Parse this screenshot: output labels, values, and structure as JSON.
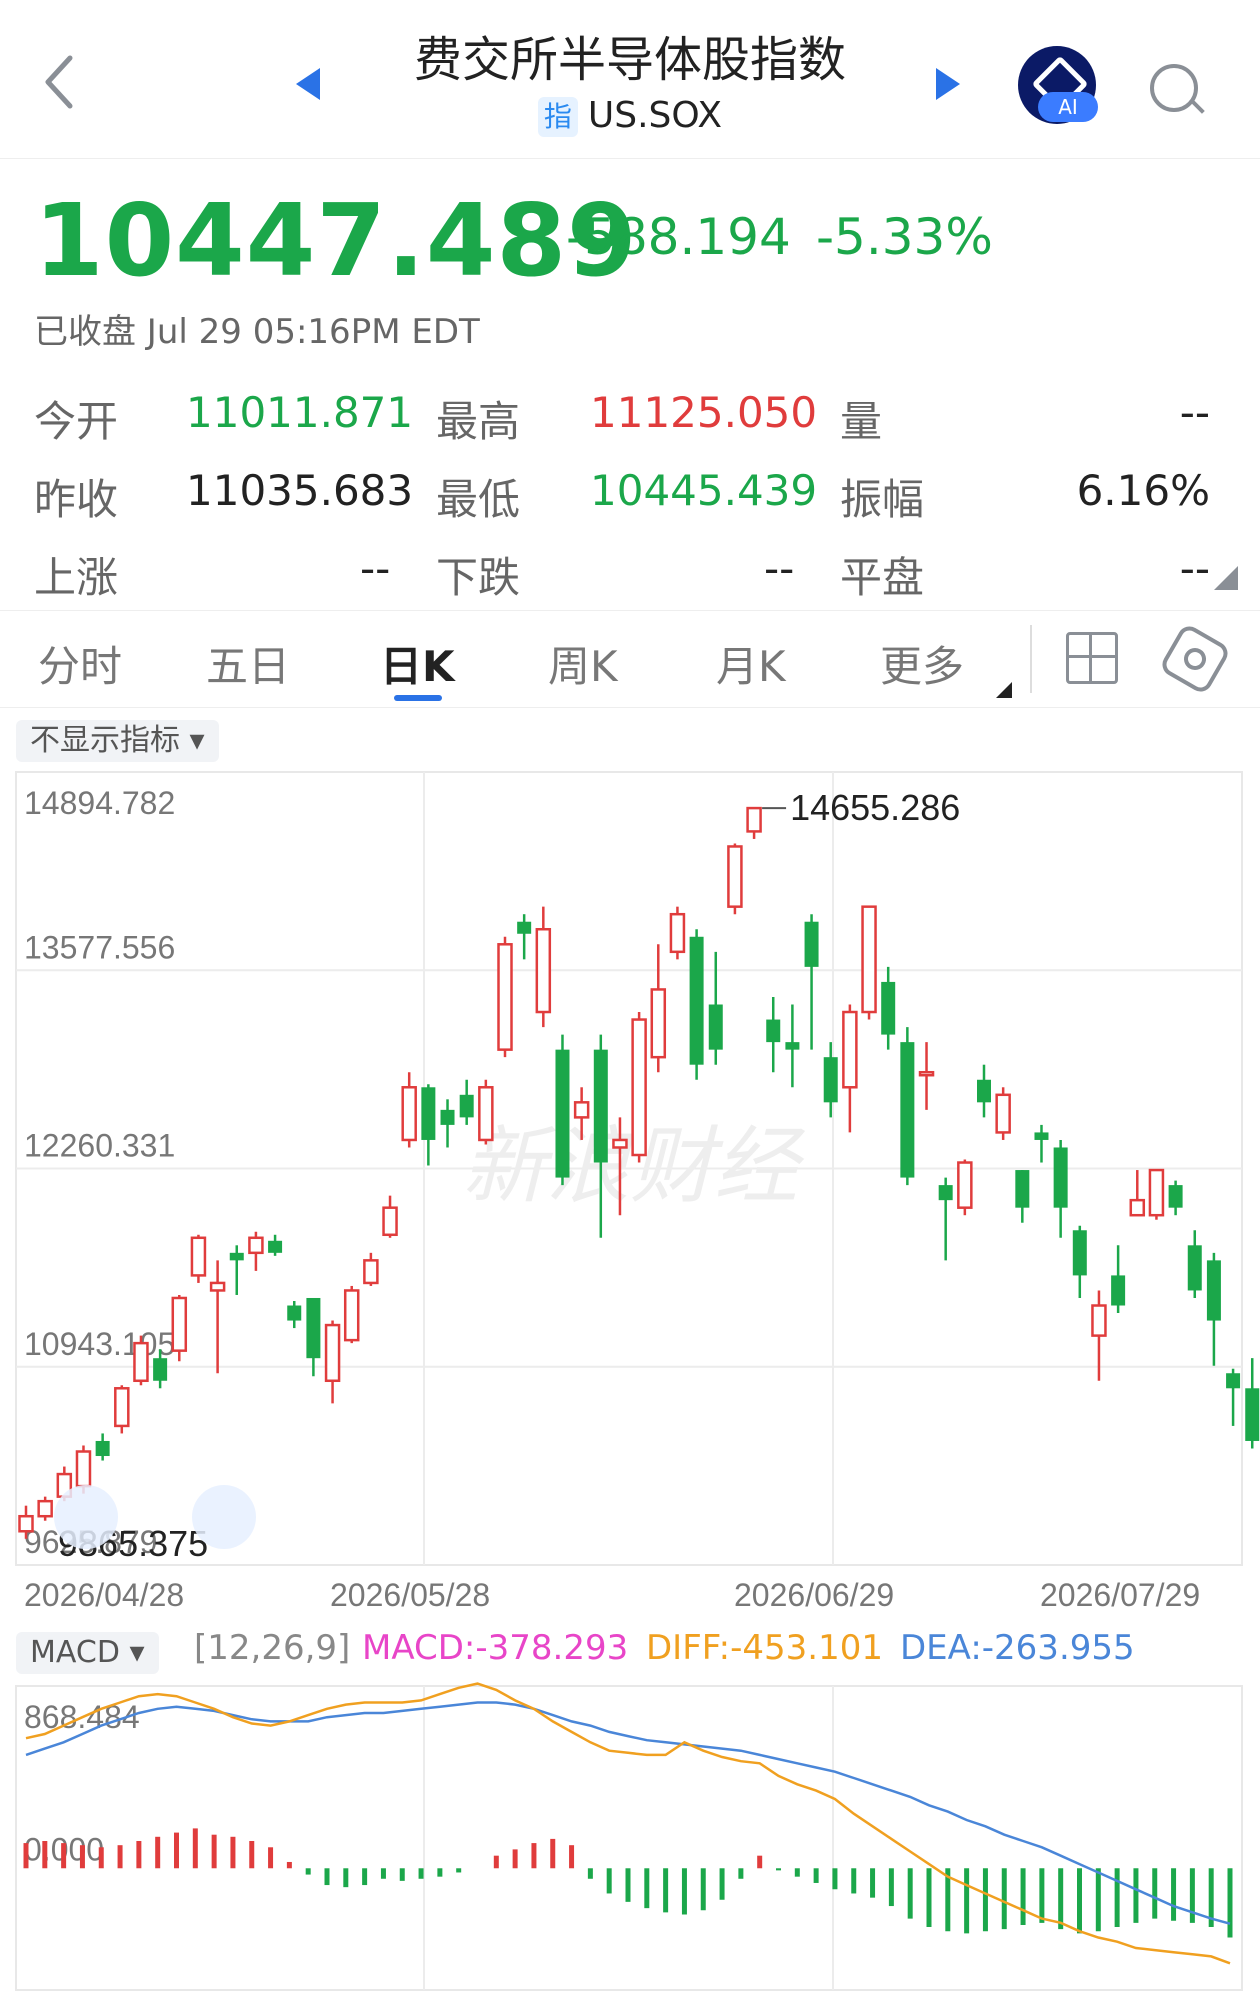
{
  "header": {
    "title": "费交所半导体股指数",
    "tag": "指",
    "symbol": "US.SOX",
    "ai_badge": "AI"
  },
  "quote": {
    "price": "10447.489",
    "change": "-588.194",
    "change_pct": "-5.33%",
    "status": "已收盘 Jul 29 05:16PM EDT",
    "open_label": "今开",
    "open": "11011.871",
    "high_label": "最高",
    "high": "11125.050",
    "vol_label": "量",
    "vol": "--",
    "prev_label": "昨收",
    "prev": "11035.683",
    "low_label": "最低",
    "low": "10445.439",
    "amp_label": "振幅",
    "amp": "6.16%",
    "up_label": "上涨",
    "up": "--",
    "down_label": "下跌",
    "down": "--",
    "flat_label": "平盘",
    "flat": "--"
  },
  "tabs": [
    "分时",
    "五日",
    "日K",
    "周K",
    "月K",
    "更多"
  ],
  "indicator_dropdown": "不显示指标",
  "watermark": "新浪财经",
  "colors": {
    "up": "#e03c3c",
    "down": "#1ba74a",
    "macd": "#e845c8",
    "diff": "#f0a020",
    "dea": "#4a86d8"
  },
  "chart_data": [
    {
      "type": "candlestick",
      "yticks": [
        "14894.782",
        "13577.556",
        "12260.331",
        "10943.105",
        "9625.879"
      ],
      "ylim": [
        9625.879,
        14894.782
      ],
      "xticks": [
        "2026/04/28",
        "2026/05/28",
        "2026/06/29",
        "2026/07/29"
      ],
      "annotations": {
        "max": "14655.286",
        "min": "9865.375"
      },
      "candles": [
        [
          9850,
          9950,
          9800,
          10020
        ],
        [
          9950,
          10050,
          9920,
          10080
        ],
        [
          10080,
          10230,
          10050,
          10280
        ],
        [
          10150,
          10380,
          10100,
          10420
        ],
        [
          10450,
          10350,
          10320,
          10500
        ],
        [
          10550,
          10800,
          10500,
          10820
        ],
        [
          10850,
          11100,
          10820,
          11150
        ],
        [
          11000,
          10850,
          10800,
          11060
        ],
        [
          11050,
          11400,
          10980,
          11420
        ],
        [
          11550,
          11800,
          11500,
          11820
        ],
        [
          11450,
          11500,
          10900,
          11650
        ],
        [
          11700,
          11650,
          11420,
          11750
        ],
        [
          11700,
          11800,
          11580,
          11840
        ],
        [
          11780,
          11700,
          11680,
          11820
        ],
        [
          11350,
          11250,
          11200,
          11380
        ],
        [
          11400,
          11000,
          10880,
          11400
        ],
        [
          10850,
          11220,
          10700,
          11250
        ],
        [
          11120,
          11450,
          11100,
          11480
        ],
        [
          11500,
          11650,
          11480,
          11700
        ],
        [
          11820,
          12000,
          11800,
          12080
        ],
        [
          12450,
          12800,
          12400,
          12900
        ],
        [
          12800,
          12450,
          12280,
          12820
        ],
        [
          12650,
          12550,
          12400,
          12720
        ],
        [
          12750,
          12600,
          12550,
          12850
        ],
        [
          12450,
          12800,
          12420,
          12850
        ],
        [
          13050,
          13750,
          13000,
          13800
        ],
        [
          13900,
          13820,
          13650,
          13950
        ],
        [
          13300,
          13850,
          13200,
          14000
        ],
        [
          13050,
          12200,
          12150,
          13150
        ],
        [
          12600,
          12700,
          12450,
          12800
        ],
        [
          13050,
          12300,
          11800,
          13150
        ],
        [
          12400,
          12450,
          11950,
          12600
        ],
        [
          12350,
          13250,
          12300,
          13300
        ],
        [
          13000,
          13450,
          12900,
          13750
        ],
        [
          13700,
          13950,
          13650,
          14000
        ],
        [
          13800,
          12950,
          12850,
          13850
        ],
        [
          13350,
          13050,
          12950,
          13700
        ],
        [
          14000,
          14400,
          13950,
          14420
        ],
        [
          14500,
          14655,
          14450,
          14655
        ],
        [
          13250,
          13100,
          12900,
          13400
        ],
        [
          13100,
          13050,
          12800,
          13350
        ],
        [
          13900,
          13600,
          13050,
          13950
        ],
        [
          13000,
          12700,
          12600,
          13100
        ],
        [
          12800,
          13300,
          12500,
          13350
        ],
        [
          13300,
          14000,
          13250,
          14000
        ],
        [
          13500,
          13150,
          13050,
          13600
        ],
        [
          13100,
          12200,
          12150,
          13200
        ],
        [
          12900,
          12900,
          12650,
          13100
        ],
        [
          12150,
          12050,
          11650,
          12200
        ],
        [
          12000,
          12300,
          11950,
          12320
        ],
        [
          12850,
          12700,
          12600,
          12950
        ],
        [
          12500,
          12750,
          12450,
          12800
        ],
        [
          12250,
          12000,
          11900,
          12250
        ],
        [
          12500,
          12450,
          12300,
          12550
        ],
        [
          12400,
          12000,
          11800,
          12450
        ],
        [
          11850,
          11550,
          11400,
          11880
        ],
        [
          11150,
          11350,
          10850,
          11450
        ],
        [
          11550,
          11350,
          11300,
          11750
        ],
        [
          11950,
          12050,
          11950,
          12250
        ],
        [
          11950,
          12250,
          11920,
          12250
        ],
        [
          12150,
          12000,
          11950,
          12180
        ],
        [
          11750,
          11450,
          11400,
          11850
        ],
        [
          11650,
          11250,
          10950,
          11700
        ],
        [
          10900,
          10800,
          10550,
          10930
        ],
        [
          10800,
          10450,
          10400,
          11000
        ]
      ]
    },
    {
      "type": "macd",
      "params": "[12,26,9]",
      "macd_label": "MACD:-378.293",
      "diff_label": "DIFF:-453.101",
      "dea_label": "DEA:-263.955",
      "series_selector": "MACD",
      "yticks": [
        "868.484",
        "0.000"
      ],
      "ylim": [
        -580,
        868.484
      ],
      "hist": [
        120,
        130,
        120,
        110,
        100,
        110,
        130,
        150,
        170,
        190,
        160,
        150,
        130,
        100,
        30,
        -30,
        -80,
        -90,
        -80,
        -50,
        -60,
        -50,
        -40,
        -20,
        0,
        60,
        90,
        120,
        140,
        110,
        -50,
        -120,
        -160,
        -190,
        -210,
        -220,
        -200,
        -150,
        -50,
        60,
        -10,
        -40,
        -70,
        -100,
        -120,
        -140,
        -180,
        -240,
        -280,
        -300,
        -310,
        -300,
        -290,
        -270,
        -260,
        -290,
        -310,
        -300,
        -280,
        -260,
        -240,
        -250,
        -260,
        -280,
        -330
      ],
      "diff": [
        620,
        640,
        680,
        720,
        760,
        790,
        820,
        830,
        820,
        790,
        760,
        720,
        690,
        680,
        700,
        730,
        760,
        780,
        790,
        790,
        790,
        800,
        830,
        860,
        880,
        850,
        800,
        760,
        700,
        650,
        600,
        560,
        550,
        540,
        540,
        600,
        560,
        530,
        510,
        500,
        440,
        400,
        370,
        330,
        260,
        200,
        140,
        80,
        20,
        -40,
        -80,
        -120,
        -160,
        -200,
        -240,
        -260,
        -300,
        -330,
        -350,
        -380,
        -390,
        -400,
        -410,
        -420,
        -453
      ],
      "dea": [
        540,
        570,
        600,
        640,
        680,
        710,
        740,
        760,
        770,
        760,
        750,
        730,
        710,
        700,
        700,
        700,
        720,
        730,
        740,
        740,
        750,
        760,
        770,
        780,
        790,
        790,
        780,
        760,
        730,
        700,
        680,
        650,
        630,
        610,
        600,
        590,
        580,
        570,
        560,
        540,
        520,
        500,
        480,
        460,
        430,
        400,
        370,
        340,
        300,
        270,
        230,
        200,
        160,
        130,
        100,
        60,
        20,
        -20,
        -60,
        -100,
        -140,
        -180,
        -210,
        -240,
        -264
      ]
    }
  ]
}
